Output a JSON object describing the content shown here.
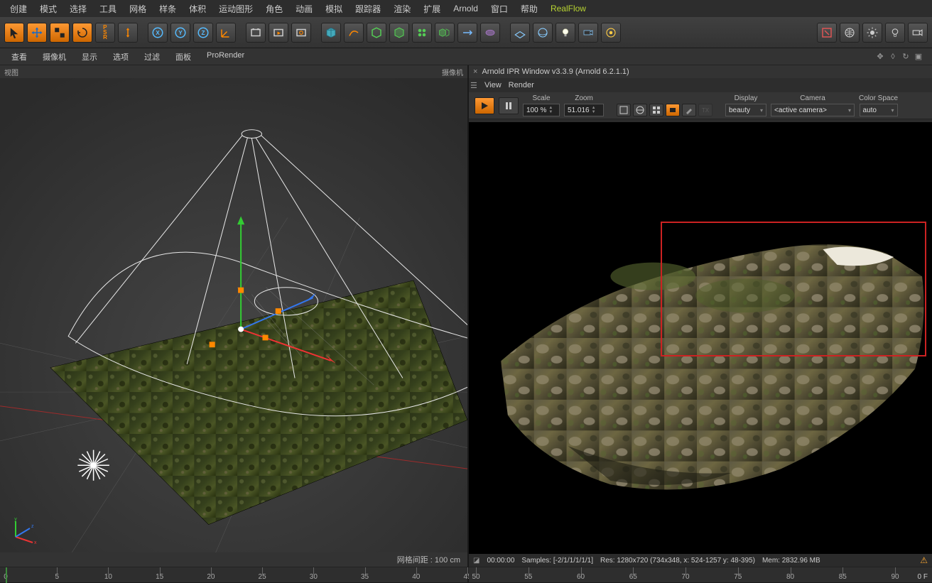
{
  "menu": [
    "创建",
    "模式",
    "选择",
    "工具",
    "网格",
    "样条",
    "体积",
    "运动图形",
    "角色",
    "动画",
    "模拟",
    "跟踪器",
    "渲染",
    "扩展",
    "Arnold",
    "窗口",
    "帮助",
    "RealFlow"
  ],
  "menu_highlight_index": 17,
  "sec_menu": [
    "查看",
    "摄像机",
    "显示",
    "选项",
    "过滤",
    "面板",
    "ProRender"
  ],
  "vp": {
    "left_label": "视图",
    "right_label": "摄像机"
  },
  "left_status": "网格间距 : 100 cm",
  "left_ruler": {
    "start": 0,
    "ticks": [
      0,
      5,
      10,
      15,
      20,
      25,
      30,
      35,
      40,
      45
    ],
    "end": 45,
    "marker": 0
  },
  "ipr": {
    "title": "Arnold IPR Window v3.3.9 (Arnold 6.2.1.1)",
    "menu": [
      "View",
      "Render"
    ],
    "scale_label": "Scale",
    "scale_value": "100 %",
    "zoom_label": "Zoom",
    "zoom_value": "51.016",
    "display_label": "Display",
    "display_value": "beauty",
    "camera_label": "Camera",
    "camera_value": "<active camera>",
    "colorspace_label": "Color Space",
    "colorspace_value": "auto",
    "status_time": "00:00:00",
    "status_samples": "Samples: [-2/1/1/1/1/1]",
    "status_res": "Res: 1280x720 (734x348, x: 524-1257 y: 48-395)",
    "status_mem": "Mem: 2832.96 MB",
    "ruler_ticks": [
      50,
      55,
      60,
      65,
      70,
      75,
      80,
      85,
      90
    ],
    "ruler_end_label": "0 F"
  }
}
